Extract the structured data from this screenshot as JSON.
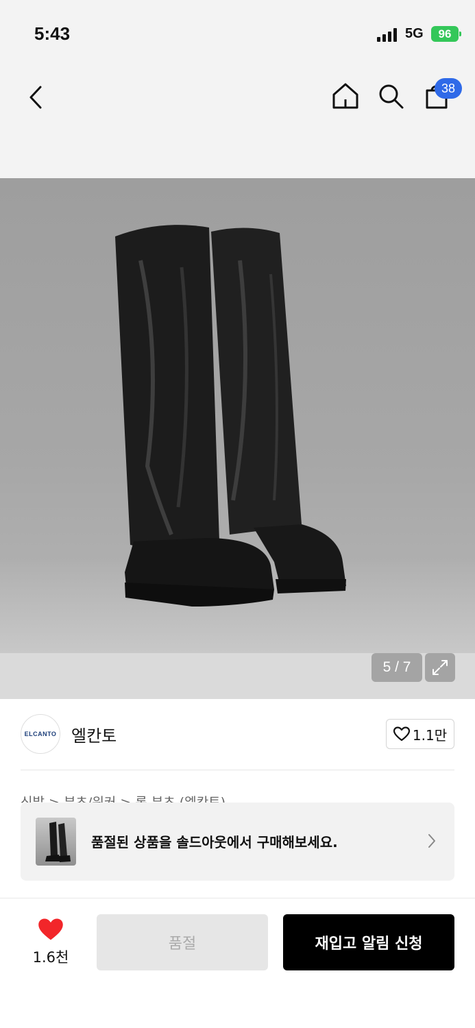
{
  "status": {
    "time": "5:43",
    "network": "5G",
    "battery": "96"
  },
  "nav": {
    "cart_count": "38"
  },
  "gallery": {
    "counter": "5 / 7"
  },
  "brand": {
    "logo_text": "ELCANTO",
    "name": "엘칸토",
    "likes": "1.1만"
  },
  "breadcrumb": {
    "text": "신발 > 부츠/워커 > 롱 부츠 (엘칸토)"
  },
  "soldout_banner": {
    "text": "품절된 상품을 솔드아웃에서 구매해보세요."
  },
  "bottom": {
    "heart_count": "1.6천",
    "soldout_label": "품절",
    "restock_label": "재입고 알림 신청"
  },
  "colors": {
    "accent_blue": "#2f6ae8",
    "battery_green": "#34c759",
    "heart_red": "#f2262a"
  }
}
